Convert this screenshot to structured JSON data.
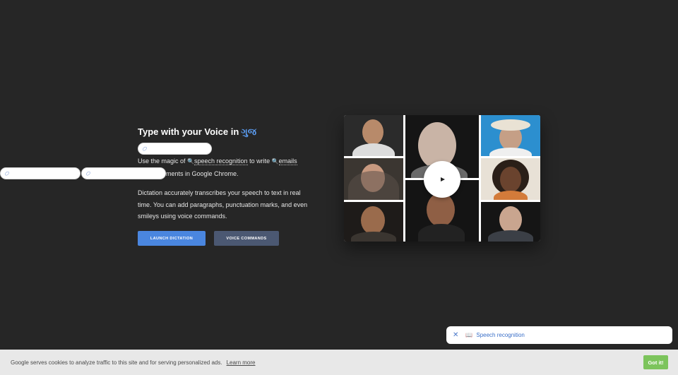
{
  "hero": {
    "title": "Type with your Voice in",
    "language": "ગુજ",
    "para1": {
      "prefix": "Use the magic of",
      "link1": "speech recognition",
      "middle": "to write",
      "link2": "emails",
      "suffix": "ments in Google Chrome."
    },
    "para2": "Dictation accurately transcribes your speech to text in real time. You can add paragraphs, punctuation marks, and even smileys using voice commands."
  },
  "buttons": {
    "launch": "LAUNCH DICTATION",
    "commands": "VOICE COMMANDS"
  },
  "video": {
    "play_icon": "play-icon"
  },
  "chip": {
    "label": "Speech recognition",
    "close_icon": "close-icon",
    "book_icon": "book-icon"
  },
  "cookie": {
    "text": "Google serves cookies to analyze traffic to this site and for serving personalized ads.",
    "learn_more": "Learn more",
    "got_it": "Got it!"
  },
  "colors": {
    "background": "#262626",
    "accent_blue": "#4a86df",
    "commands_button": "#4b5872",
    "language_highlight": "#5b9cf0",
    "got_it_green": "#7cc45c"
  }
}
